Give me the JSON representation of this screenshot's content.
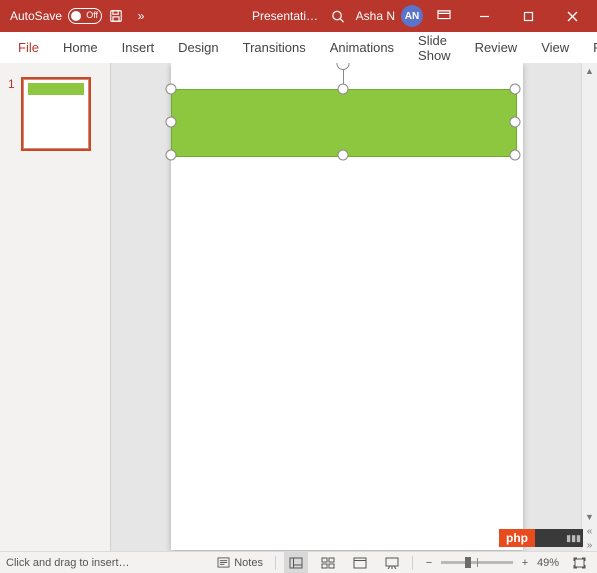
{
  "titlebar": {
    "autosave_label": "AutoSave",
    "autosave_state": "Off",
    "doc_title": "Presentati…",
    "user_name": "Asha N",
    "user_initials": "AN"
  },
  "ribbon": {
    "tabs": [
      "File",
      "Home",
      "Insert",
      "Design",
      "Transitions",
      "Animations",
      "Slide Show",
      "Review",
      "View",
      "Recordi"
    ]
  },
  "thumbs": {
    "items": [
      {
        "num": "1"
      }
    ]
  },
  "shape": {
    "fill": "#8dc63f"
  },
  "badge": {
    "text": "php"
  },
  "statusbar": {
    "message": "Click and drag to insert…",
    "notes_label": "Notes",
    "zoom_pct": "49%"
  }
}
